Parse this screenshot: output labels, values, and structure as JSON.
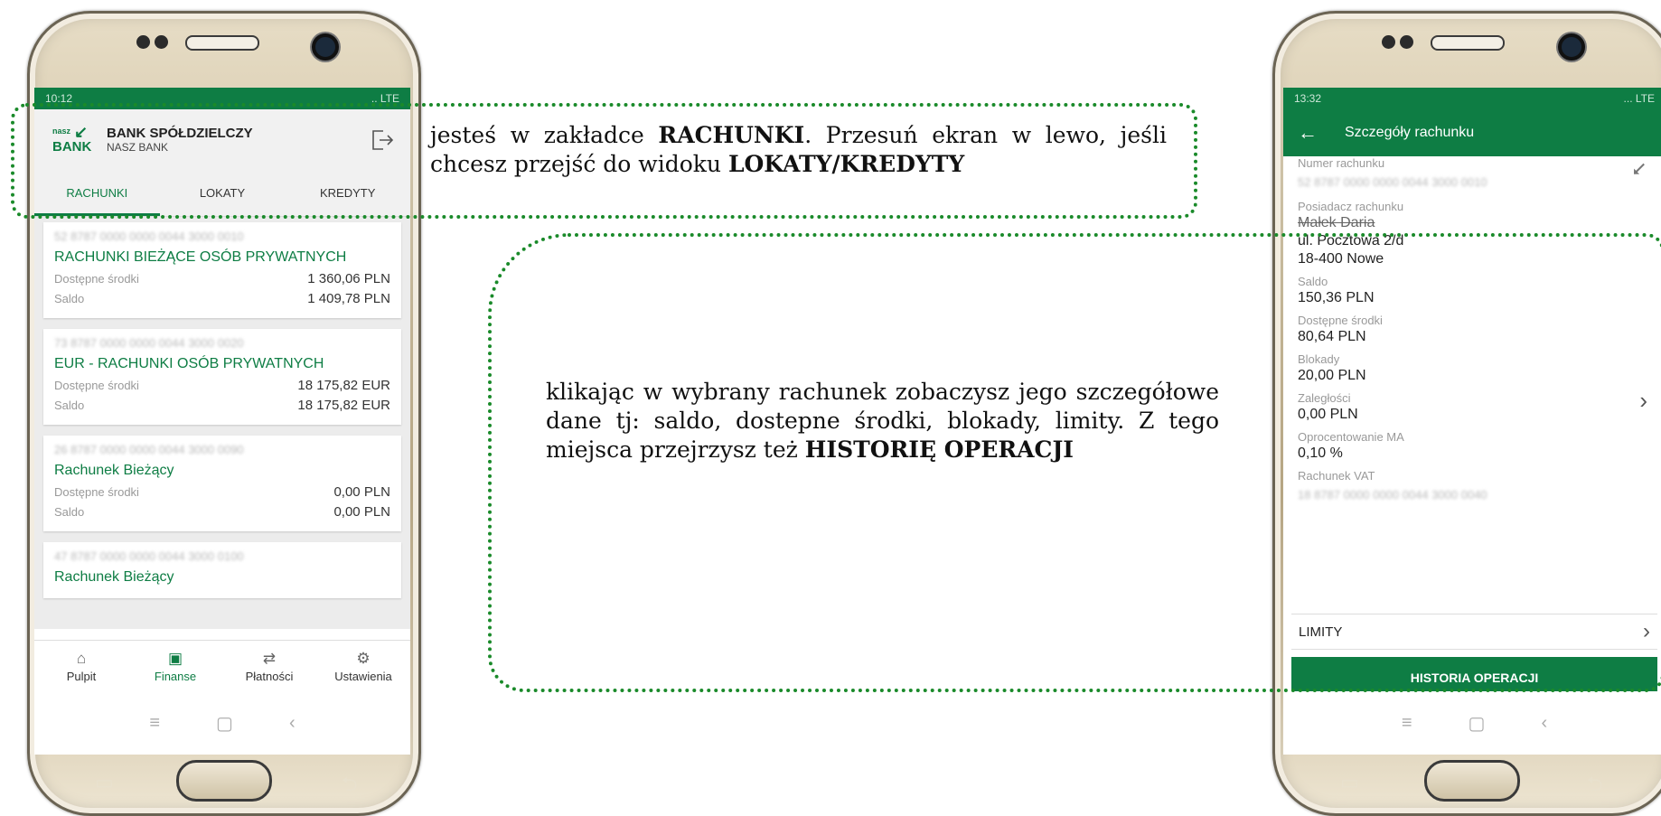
{
  "left_phone": {
    "status_time": "10:12",
    "status_icons": ".. LTE",
    "bank_name": "BANK SPÓŁDZIELCZY",
    "bank_sub": "NASZ BANK",
    "logo_small": "nasz",
    "logo_big": "BANK",
    "tabs": [
      {
        "label": "RACHUNKI"
      },
      {
        "label": "LOKATY"
      },
      {
        "label": "KREDYTY"
      }
    ],
    "accounts": [
      {
        "number": "52 8787 0000 0000 0044 3000 0010",
        "name": "RACHUNKI BIEŻĄCE OSÓB PRYWATNYCH",
        "avail_label": "Dostępne środki",
        "avail": "1 360,06 PLN",
        "saldo_label": "Saldo",
        "saldo": "1 409,78 PLN"
      },
      {
        "number": "73 8787 0000 0000 0044 3000 0020",
        "name": "EUR - RACHUNKI OSÓB PRYWATNYCH",
        "avail_label": "Dostępne środki",
        "avail": "18 175,82 EUR",
        "saldo_label": "Saldo",
        "saldo": "18 175,82 EUR"
      },
      {
        "number": "26 8787 0000 0000 0044 3000 0090",
        "name": "Rachunek Bieżący",
        "avail_label": "Dostępne środki",
        "avail": "0,00 PLN",
        "saldo_label": "Saldo",
        "saldo": "0,00 PLN"
      },
      {
        "number": "47 8787 0000 0000 0044 3000 0100",
        "name": "Rachunek Bieżący"
      }
    ],
    "bottom_nav": [
      {
        "label": "Pulpit",
        "icon": "home-icon"
      },
      {
        "label": "Finanse",
        "icon": "wallet-icon"
      },
      {
        "label": "Płatności",
        "icon": "transfer-icon"
      },
      {
        "label": "Ustawienia",
        "icon": "gear-icon"
      }
    ]
  },
  "right_phone": {
    "status_time": "13:32",
    "status_icons": "... LTE",
    "title": "Szczegóły rachunku",
    "fields": {
      "numer_label": "Numer rachunku",
      "numer": "52 8787 0000 0000 0044 3000 0010",
      "posiadacz_label": "Posiadacz rachunku",
      "posiadacz_name": "Małek Daria",
      "posiadacz_addr1": "ul. Pocztowa 2/d",
      "posiadacz_addr2": "18-400 Nowe",
      "saldo_label": "Saldo",
      "saldo": "150,36 PLN",
      "dostepne_label": "Dostępne środki",
      "dostepne": "80,64 PLN",
      "blokady_label": "Blokady",
      "blokady": "20,00 PLN",
      "zaleglosci_label": "Zaległości",
      "zaleglosci": "0,00 PLN",
      "oproc_label": "Oprocentowanie MA",
      "oproc": "0,10 %",
      "vat_label": "Rachunek VAT",
      "vat": "18 8787 0000 0000 0044 3000 0040"
    },
    "limity_label": "LIMITY",
    "historia_label": "HISTORIA OPERACJI"
  },
  "annotations": {
    "a1_pre": "jesteś w zakładce ",
    "a1_b1": "RACHUNKI",
    "a1_mid": ". Przesuń ekran w lewo, jeśli chcesz przejść do widoku ",
    "a1_b2": "LOKATY/KREDYTY",
    "a2_pre": "klikając w wybrany rachunek zobaczysz jego szczegółowe dane tj: saldo, dostepne środki, blokady, limity. Z tego miejsca przejrzysz też ",
    "a2_b": "HISTORIĘ OPERACJI"
  },
  "colors": {
    "brand_green": "#0e7d44",
    "callout_green": "#1a8a2a"
  }
}
